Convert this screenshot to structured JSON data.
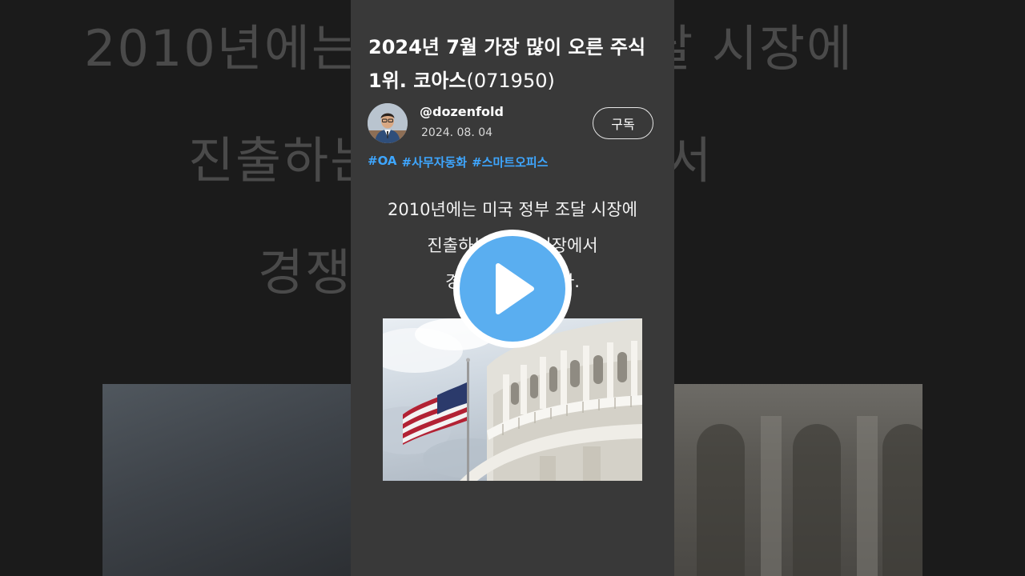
{
  "background": {
    "lines": [
      "2010년에는 미국 정부 조달 시장에",
      "진출하는 데 이 시장에서",
      "경쟁력을 갖춥니다."
    ]
  },
  "video": {
    "title_main": "2024년 7월 가장 많이 오른 주식 1위. 코아스",
    "title_code": "(071950)",
    "channel_handle": "@dozenfold",
    "date": "2024. 08. 04",
    "subscribe_label": "구독",
    "tags": [
      "#OA",
      "#사무자동화",
      "#스마트오피스"
    ],
    "body_lines": [
      "2010년에는 미국 정부 조달 시장에",
      "진출하는 데 이 시장에서",
      "경쟁력을 갖춥니다."
    ]
  },
  "colors": {
    "card_bg": "#393939",
    "tag": "#3ea6ff",
    "play": "#5aaef0"
  },
  "icons": {
    "play": "play-icon",
    "avatar": "avatar"
  }
}
